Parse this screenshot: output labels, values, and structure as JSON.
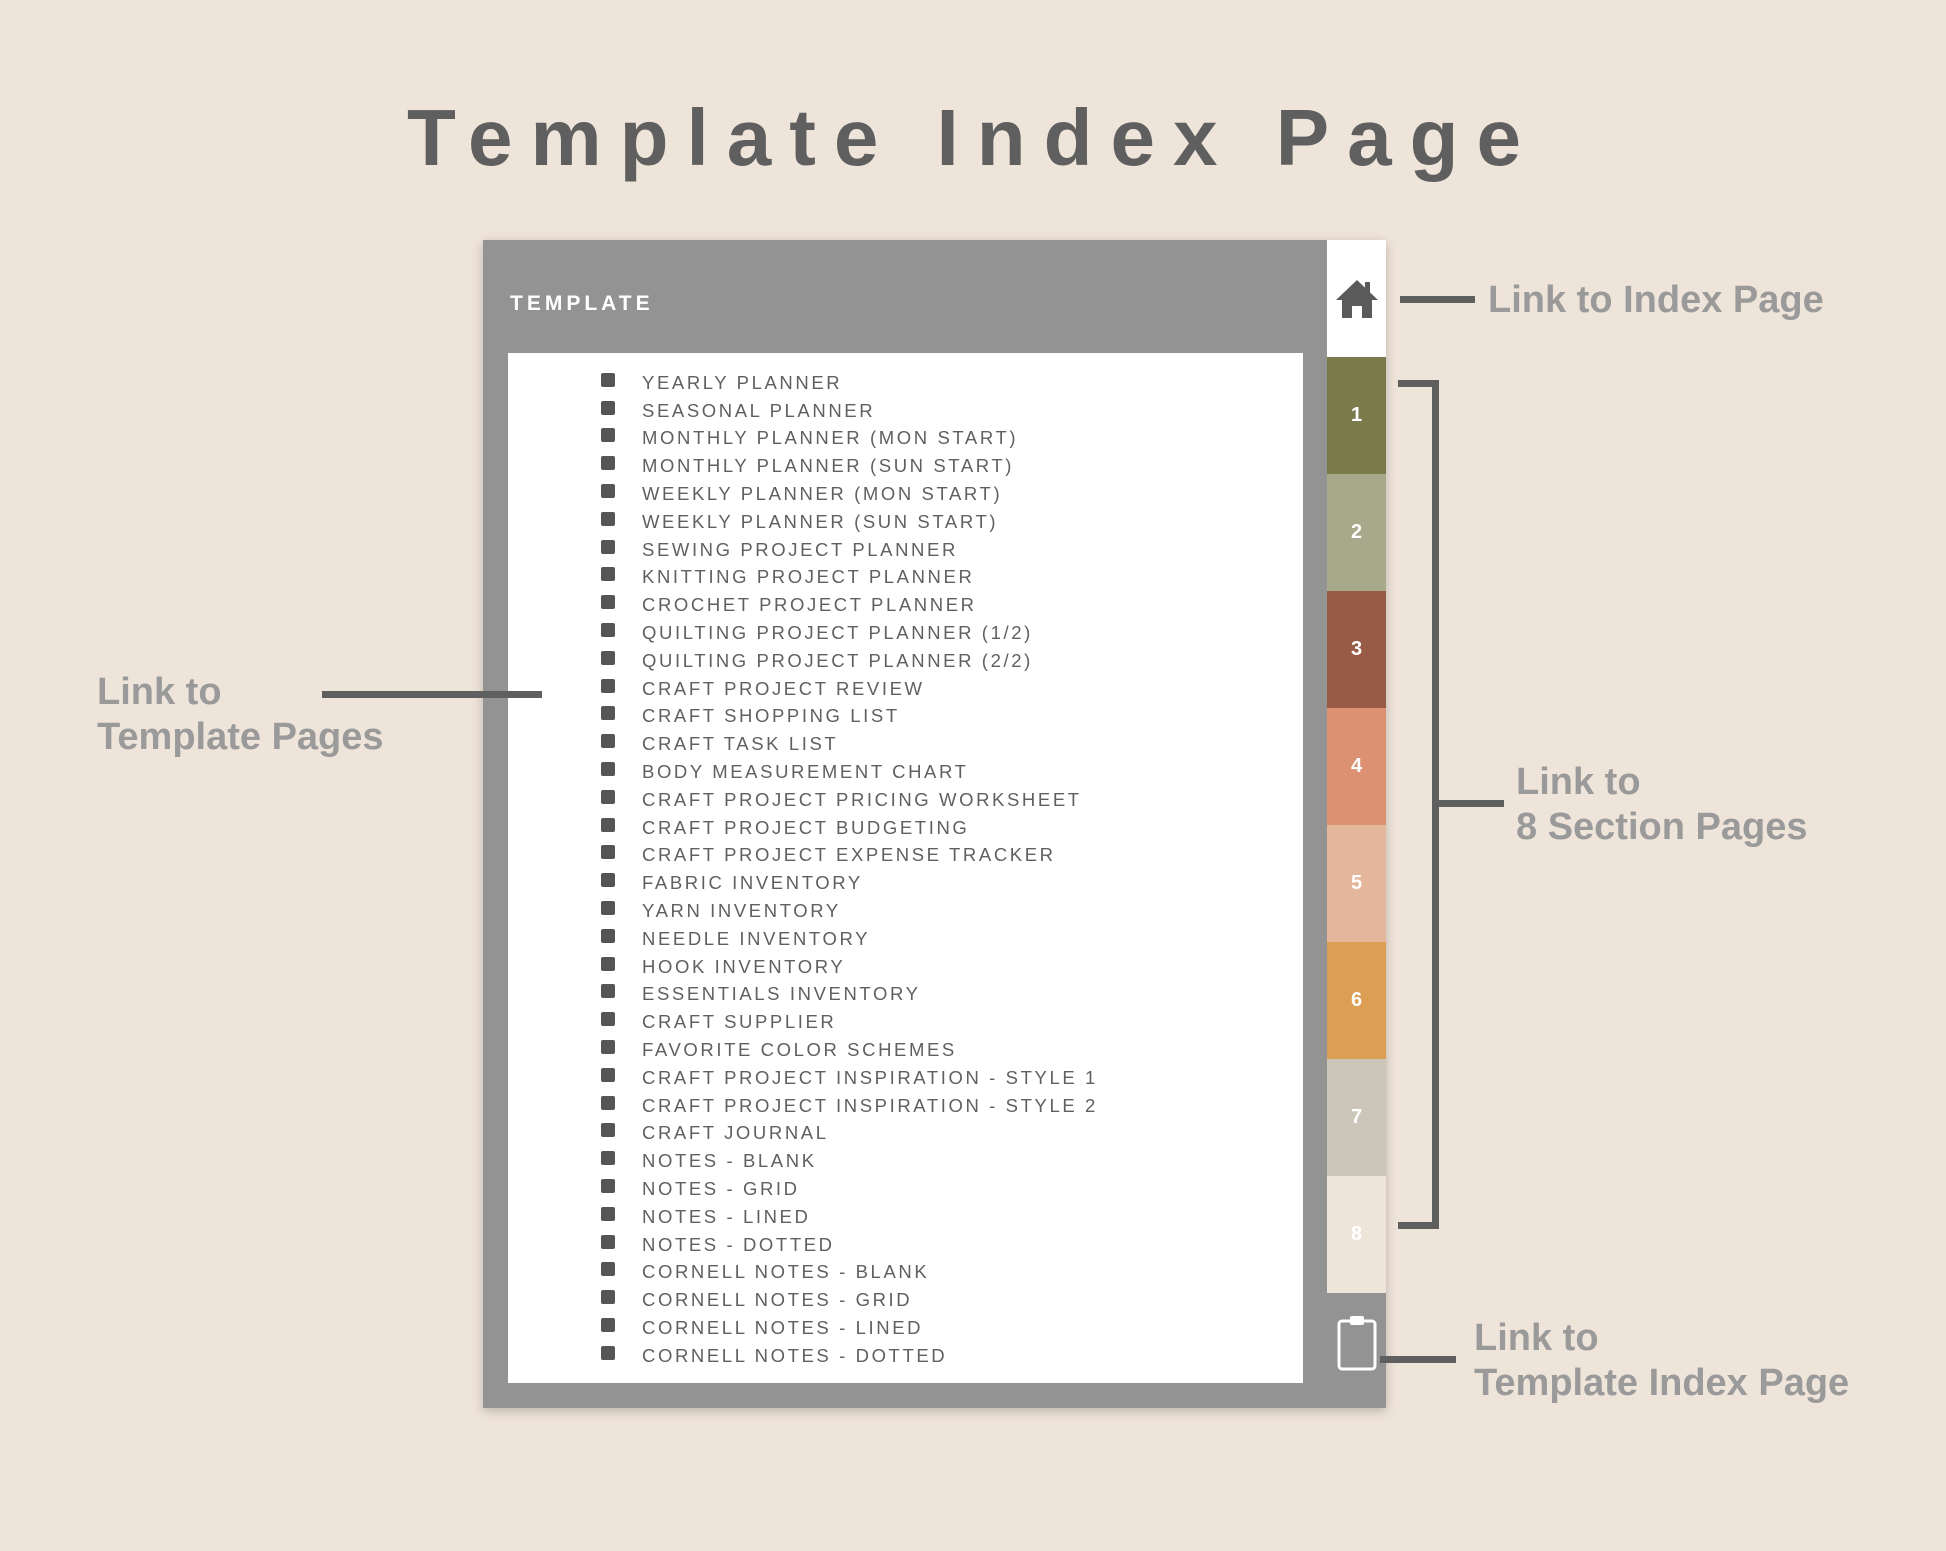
{
  "title": "Template Index Page",
  "planner": {
    "header": "TEMPLATE",
    "templates": [
      "YEARLY PLANNER",
      "SEASONAL PLANNER",
      "MONTHLY PLANNER (MON START)",
      "MONTHLY PLANNER (SUN START)",
      "WEEKLY PLANNER (MON START)",
      "WEEKLY PLANNER (SUN START)",
      "SEWING PROJECT PLANNER",
      "KNITTING PROJECT PLANNER",
      "CROCHET PROJECT PLANNER",
      "QUILTING PROJECT PLANNER (1/2)",
      "QUILTING PROJECT PLANNER (2/2)",
      "CRAFT PROJECT REVIEW",
      "CRAFT SHOPPING LIST",
      "CRAFT TASK LIST",
      "BODY MEASUREMENT CHART",
      "CRAFT PROJECT PRICING WORKSHEET",
      "CRAFT PROJECT BUDGETING",
      "CRAFT PROJECT EXPENSE TRACKER",
      "FABRIC INVENTORY",
      "YARN INVENTORY",
      "NEEDLE INVENTORY",
      "HOOK INVENTORY",
      "ESSENTIALS INVENTORY",
      "CRAFT SUPPLIER",
      "FAVORITE COLOR SCHEMES",
      "CRAFT PROJECT INSPIRATION - STYLE 1",
      "CRAFT PROJECT INSPIRATION - STYLE 2",
      "CRAFT JOURNAL",
      "NOTES - BLANK",
      "NOTES - GRID",
      "NOTES - LINED",
      "NOTES - DOTTED",
      "CORNELL NOTES - BLANK",
      "CORNELL NOTES - GRID",
      "CORNELL NOTES - LINED",
      "CORNELL NOTES - DOTTED"
    ]
  },
  "sidebar": {
    "home_icon": "home-icon",
    "template_index_icon": "clipboard-icon",
    "sections": [
      {
        "label": "1",
        "color": "#7a7a4a"
      },
      {
        "label": "2",
        "color": "#a8a88a"
      },
      {
        "label": "3",
        "color": "#985b45"
      },
      {
        "label": "4",
        "color": "#dc9272"
      },
      {
        "label": "5",
        "color": "#e4b79c"
      },
      {
        "label": "6",
        "color": "#dc9e52"
      },
      {
        "label": "7",
        "color": "#cbc6b9"
      },
      {
        "label": "8",
        "color": "#efe4da"
      }
    ]
  },
  "annotations": {
    "index_page_line1": "Link to Index Page",
    "template_pages_line1": "Link to",
    "template_pages_line2": "Template Pages",
    "section_pages_line1": "Link to",
    "section_pages_line2": "8 Section Pages",
    "template_index_line1": "Link to",
    "template_index_line2": "Template Index Page"
  },
  "colors": {
    "background": "#efe4da",
    "frame": "#939393",
    "text_dark": "#5f5f5f",
    "annotation": "#9a9a9a"
  }
}
